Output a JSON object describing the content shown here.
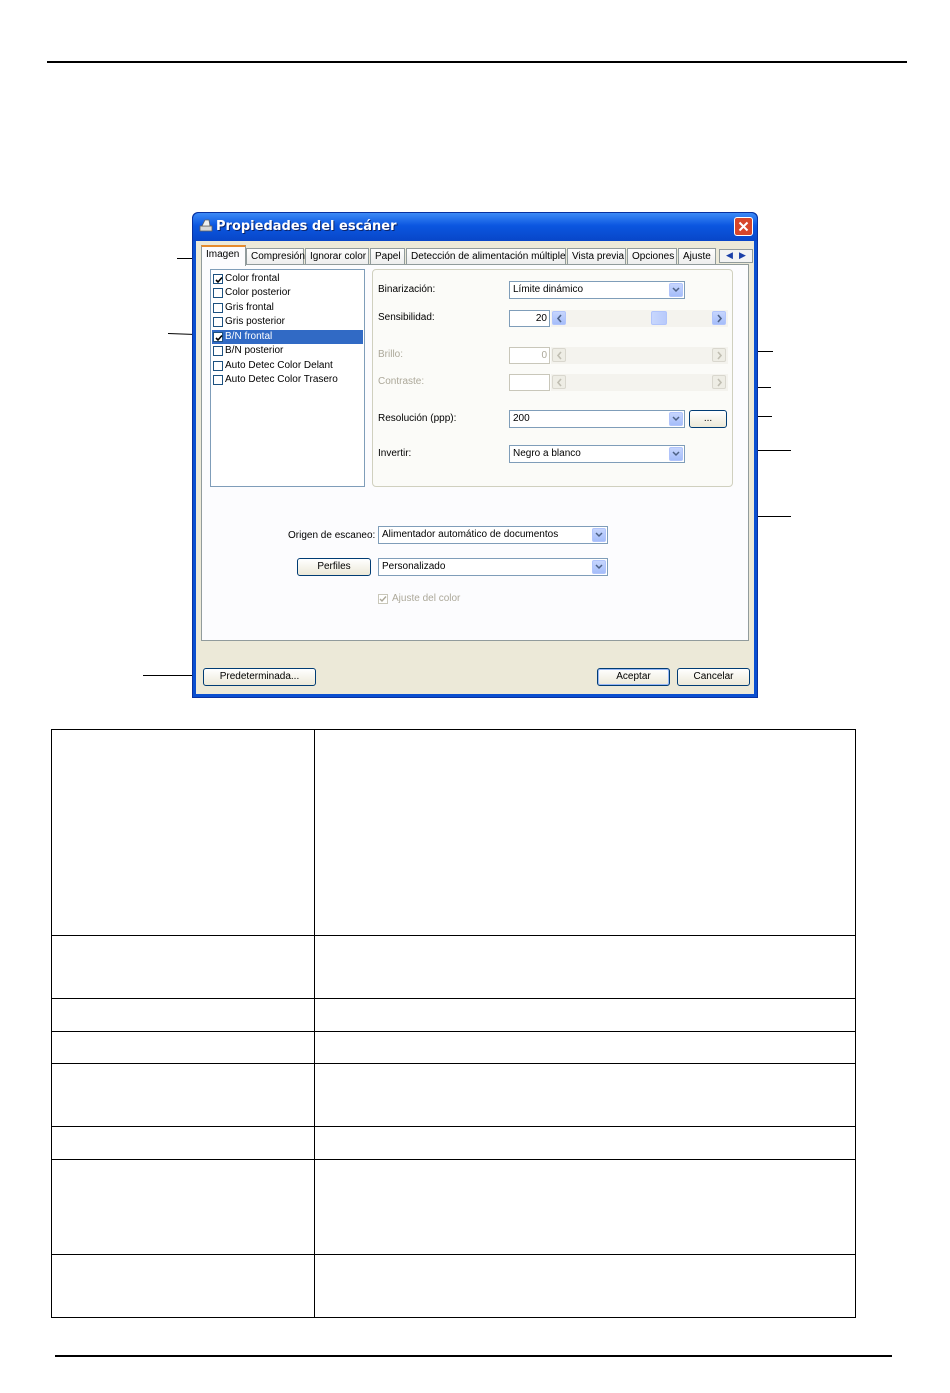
{
  "dialog": {
    "title": "Propiedades del escáner",
    "tabs": [
      "Imagen",
      "Compresión",
      "Ignorar color",
      "Papel",
      "Detección de alimentación múltiple",
      "Vista previa",
      "Opciones",
      "Ajuste"
    ],
    "image_list": [
      {
        "label": "Color frontal",
        "checked": true,
        "selected": false
      },
      {
        "label": "Color posterior",
        "checked": false,
        "selected": false
      },
      {
        "label": "Gris frontal",
        "checked": false,
        "selected": false
      },
      {
        "label": "Gris posterior",
        "checked": false,
        "selected": false
      },
      {
        "label": "B/N frontal",
        "checked": true,
        "selected": true
      },
      {
        "label": "B/N posterior",
        "checked": false,
        "selected": false
      },
      {
        "label": "Auto Detec Color Delant",
        "checked": false,
        "selected": false
      },
      {
        "label": "Auto Detec Color Trasero",
        "checked": false,
        "selected": false
      }
    ],
    "binarization": {
      "label": "Binarización:",
      "value": "Límite dinámico"
    },
    "sensitivity": {
      "label": "Sensibilidad:",
      "value": "20"
    },
    "brightness": {
      "label": "Brillo:",
      "value": "0"
    },
    "contrast": {
      "label": "Contraste:",
      "value": ""
    },
    "resolution": {
      "label": "Resolución (ppp):",
      "value": "200",
      "more_button": "..."
    },
    "invert": {
      "label": "Invertir:",
      "value": "Negro a blanco"
    },
    "scan_source": {
      "label": "Origen de escaneo:",
      "value": "Alimentador automático de documentos"
    },
    "profiles": {
      "button": "Perfiles",
      "value": "Personalizado"
    },
    "color_adjust": {
      "label": "Ajuste del color",
      "checked": true,
      "enabled": false
    },
    "default_button": "Predeterminada...",
    "ok_button": "Aceptar",
    "cancel_button": "Cancelar"
  },
  "colors": {
    "title_bar": "#0b56e0",
    "selection": "#316ac5",
    "window_face": "#ece9d8",
    "close_button": "#d7462a"
  }
}
